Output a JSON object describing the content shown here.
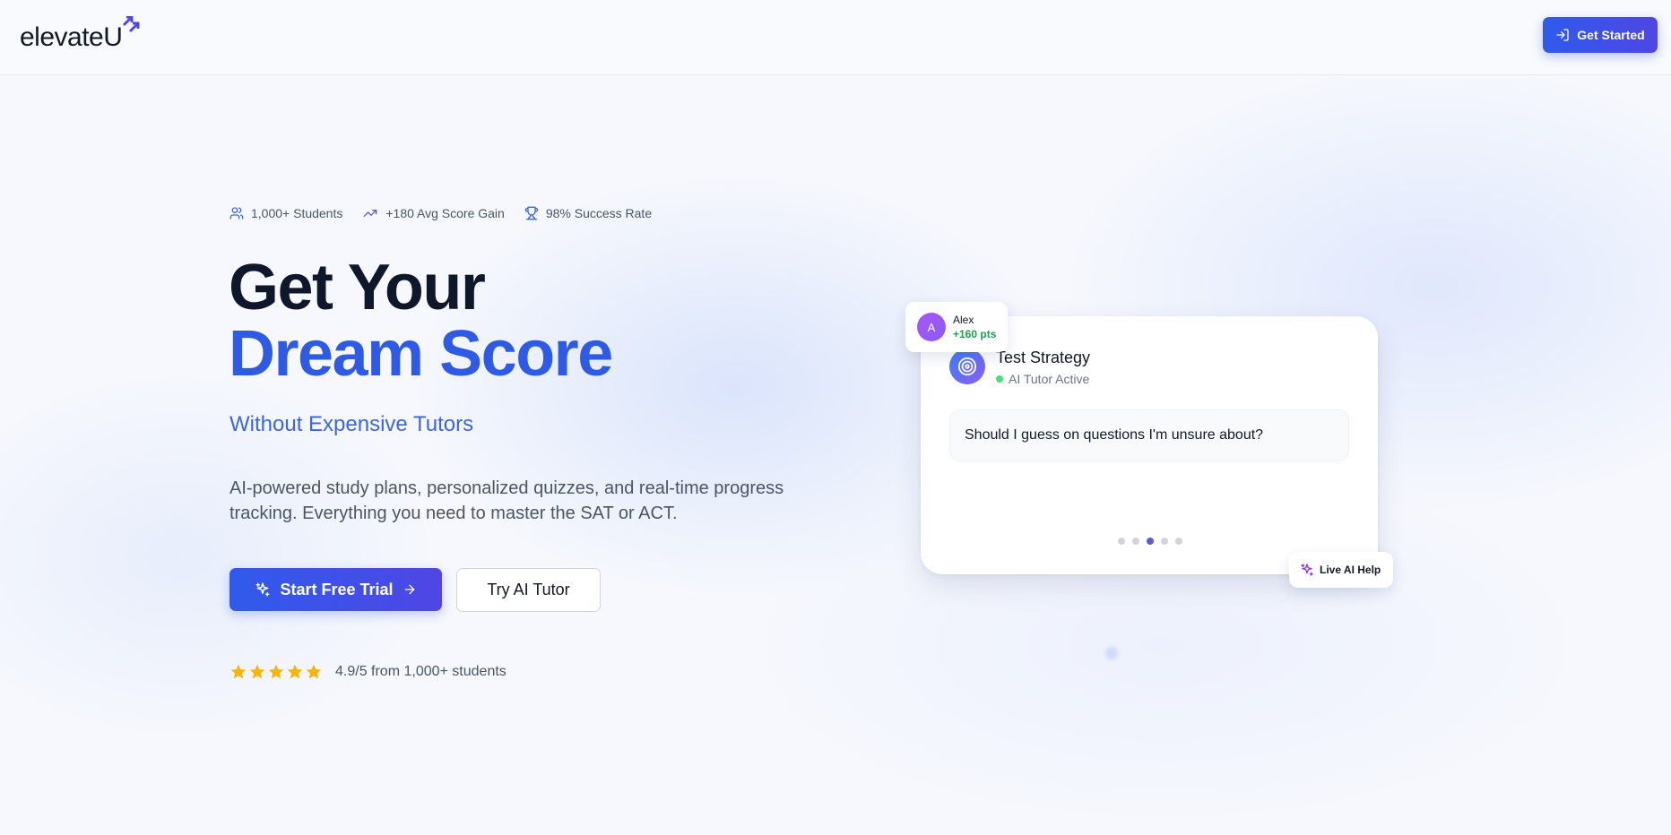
{
  "brand": {
    "name": "elevateU"
  },
  "header": {
    "cta_label": "Get Started"
  },
  "hero": {
    "stats": [
      {
        "icon": "users-icon",
        "label": "1,000+ Students"
      },
      {
        "icon": "trending-up-icon",
        "label": "+180 Avg Score Gain"
      },
      {
        "icon": "trophy-icon",
        "label": "98% Success Rate"
      }
    ],
    "headline_line1": "Get Your",
    "headline_line2": "Dream Score",
    "subheadline": "Without Expensive Tutors",
    "description": "AI-powered study plans, personalized quizzes, and real-time progress tracking. Everything you need to master the SAT or ACT.",
    "primary_cta": "Start Free Trial",
    "secondary_cta": "Try AI Tutor",
    "rating": {
      "stars": 5,
      "text": "4.9/5 from 1,000+ students"
    }
  },
  "card": {
    "title": "Test Strategy",
    "status": "AI Tutor Active",
    "question": "Should I guess on questions I'm unsure about?",
    "carousel": {
      "total": 5,
      "active_index": 2
    }
  },
  "badge_user": {
    "initial": "A",
    "name": "Alex",
    "points": "+160 pts"
  },
  "badge_live": {
    "label": "Live AI Help"
  },
  "colors": {
    "primary": "#2f5be4",
    "primary_gradient_end": "#4f46e5",
    "success": "#16a34a",
    "star": "#f5b50a"
  }
}
